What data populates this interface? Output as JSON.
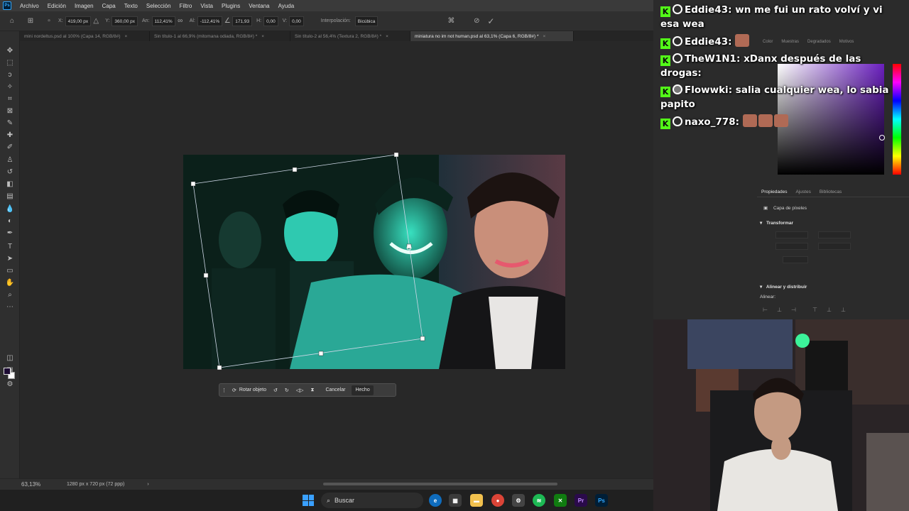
{
  "menu": {
    "items": [
      "Archivo",
      "Edición",
      "Imagen",
      "Capa",
      "Texto",
      "Selección",
      "Filtro",
      "Vista",
      "Plugins",
      "Ventana",
      "Ayuda"
    ]
  },
  "options": {
    "x_label": "X:",
    "x_value": "419,00 px",
    "y_label": "Y:",
    "y_value": "360,00 px",
    "width_label": "An:",
    "width_value": "112,41%",
    "height_label": "Al:",
    "height_value": "-112,41%",
    "rotate_value": "171,93",
    "hskew_label": "H:",
    "hskew_value": "0,00",
    "vskew_label": "V:",
    "vskew_value": "0,00",
    "interp_label": "Interpolación:",
    "interp_value": "Bicúbica"
  },
  "tabs": [
    {
      "label": "mini nordeltus.psd al 100% (Capa 14, RGB/8#)",
      "active": false
    },
    {
      "label": "Sin título-1 al 66,9% (mitomana odiada, RGB/8#) *",
      "active": false
    },
    {
      "label": "Sin título-2 al 56,4% (Textura 2, RGB/8#) *",
      "active": false
    },
    {
      "label": "miniatura no im not human.psd al 63,1% (Capa 6, RGB/8#) *",
      "active": true
    }
  ],
  "tab_close": "×",
  "task_bar": {
    "rotate_label": "Rotar objeto",
    "cancel_label": "Cancelar",
    "done_label": "Hecho"
  },
  "status": {
    "zoom": "63,13%",
    "doc_info": "1280 px x 720 px (72 ppp)"
  },
  "color_panel": {
    "tabs": [
      "Color",
      "Muestras",
      "Degradados",
      "Motivos"
    ]
  },
  "properties": {
    "tabs": [
      "Propiedades",
      "Ajustes",
      "Bibliotecas"
    ],
    "layer_type": "Capa de píxeles",
    "transform_title": "Transformar",
    "align_title": "Alinear y distribuir",
    "align_label": "Alinear:"
  },
  "chat": [
    {
      "user": "Eddie43",
      "text": "wn me fui un rato volví y vi esa wea"
    },
    {
      "user": "Eddie43",
      "text": ""
    },
    {
      "user": "TheW1N1",
      "text": "xDanx después de las drogas:"
    },
    {
      "user": "Flowwki",
      "text": "salia cualquier wea, lo sabia papito"
    },
    {
      "user": "naxo_778",
      "text": ""
    }
  ],
  "windows_taskbar": {
    "search_placeholder": "Buscar",
    "apps": [
      "edge-icon",
      "store-icon",
      "files-icon",
      "chrome-icon",
      "settings-icon",
      "spotify-icon",
      "xbox-icon",
      "premiere-icon",
      "photoshop-icon"
    ]
  },
  "colors": {
    "foreground": "#1d0b33",
    "background": "#ffffff",
    "kick_green": "#53fc18",
    "ps_blue": "#31a8ff"
  }
}
